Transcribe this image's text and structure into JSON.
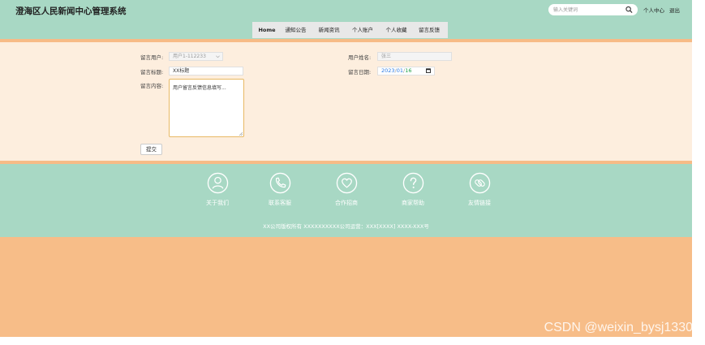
{
  "header": {
    "site_title": "澄海区人民新闻中心管理系统",
    "search": {
      "placeholder": "输入关键词",
      "icon": "search-icon"
    },
    "user_center": "个人中心",
    "logout": "退出"
  },
  "nav": {
    "items": [
      "Home",
      "通知公告",
      "新闻资讯",
      "个人账户",
      "个人收藏",
      "留言反馈"
    ]
  },
  "form": {
    "user_label": "留言用户:",
    "user_value": "用户1-112233",
    "username_label": "用户姓名:",
    "username_value": "张三",
    "title_label": "留言标题:",
    "title_value": "XX标题",
    "date_label": "留言日期:",
    "date_year": "2023",
    "date_sep1": "/",
    "date_month": "01",
    "date_sep2": "/",
    "date_day": "16",
    "content_label": "留言内容:",
    "content_value": "用户留言反馈信息填写...",
    "submit_label": "提交"
  },
  "footer": {
    "items": [
      {
        "label": "关于我们",
        "icon": "person-icon"
      },
      {
        "label": "联系客服",
        "icon": "phone-icon"
      },
      {
        "label": "合作招商",
        "icon": "heart-icon"
      },
      {
        "label": "商家帮助",
        "icon": "question-icon"
      },
      {
        "label": "友情链接",
        "icon": "link-icon"
      }
    ],
    "copyright": "XX公司版权所有 XXXXXXXXXX公司运营：XXX[XXXX] XXXX-XXX号"
  },
  "watermark": "CSDN @weixin_bysj1330",
  "colors": {
    "header": "#a8d8c4",
    "form_bg": "#fdeede",
    "stripe": "#f7bb86",
    "bottom": "#f7bd88",
    "date_accent": "#2a7ae4"
  }
}
